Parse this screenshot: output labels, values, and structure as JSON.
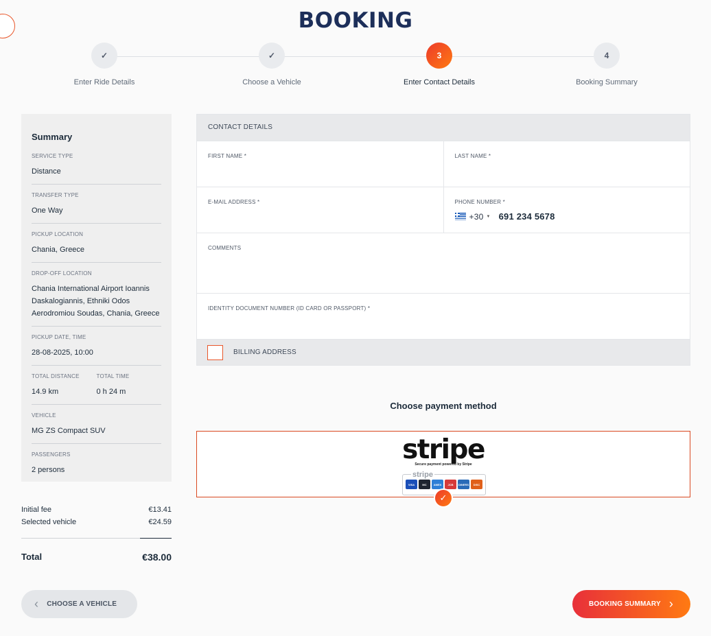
{
  "page": {
    "title": "BOOKING"
  },
  "steps": [
    {
      "icon": "check-icon",
      "label": "Enter Ride Details",
      "glyph": "✓"
    },
    {
      "icon": "check-icon",
      "label": "Choose a Vehicle",
      "glyph": "✓"
    },
    {
      "number": "3",
      "label": "Enter Contact Details",
      "glyph": "3"
    },
    {
      "number": "4",
      "label": "Booking Summary",
      "glyph": "4"
    }
  ],
  "summary": {
    "heading": "Summary",
    "service_type_label": "SERVICE TYPE",
    "service_type": "Distance",
    "transfer_type_label": "TRANSFER TYPE",
    "transfer_type": "One Way",
    "pickup_label": "PICKUP LOCATION",
    "pickup": "Chania, Greece",
    "dropoff_label": "DROP-OFF LOCATION",
    "dropoff": "Chania International Airport Ioannis Daskalogiannis, Ethniki Odos Aerodromiou Soudas, Chania, Greece",
    "datetime_label": "PICKUP DATE, TIME",
    "datetime": "28-08-2025, 10:00",
    "distance_label": "TOTAL DISTANCE",
    "distance": "14.9 km",
    "time_label": "TOTAL TIME",
    "time": "0 h 24 m",
    "vehicle_label": "VEHICLE",
    "vehicle": "MG ZS Compact SUV",
    "passengers_label": "PASSENGERS",
    "passengers": "2 persons"
  },
  "fees": {
    "initial_label": "Initial fee",
    "initial": "€13.41",
    "vehicle_label": "Selected vehicle",
    "vehicle": "€24.59",
    "total_label": "Total",
    "total": "€38.00"
  },
  "contact": {
    "heading": "CONTACT DETAILS",
    "first_name_label": "FIRST NAME *",
    "last_name_label": "LAST NAME *",
    "email_label": "E-MAIL ADDRESS *",
    "phone_label": "PHONE NUMBER *",
    "phone_code": "+30",
    "phone_value": "691 234 5678",
    "comments_label": "COMMENTS",
    "id_label": "IDENTITY DOCUMENT NUMBER (ID CARD OR PASSPORT) *",
    "billing_label": "BILLING ADDRESS"
  },
  "payment": {
    "title": "Choose payment method",
    "logo_text": "stripe",
    "tagline": "Secure payment powered by Stripe",
    "badge_label": "stripe",
    "cards": [
      {
        "name": "VISA",
        "color": "#1a4fb8"
      },
      {
        "name": "MC",
        "color": "#1f2530"
      },
      {
        "name": "AMEX",
        "color": "#2e7fd6"
      },
      {
        "name": "JCB",
        "color": "#d63a3a"
      },
      {
        "name": "DINERS",
        "color": "#2a6bb8"
      },
      {
        "name": "DISC",
        "color": "#e0601a"
      }
    ]
  },
  "nav": {
    "back_label": "CHOOSE A VEHICLE",
    "next_label": "BOOKING SUMMARY"
  },
  "colors": {
    "accent": "#ff6a1a",
    "brand": "#1d2f5a"
  }
}
